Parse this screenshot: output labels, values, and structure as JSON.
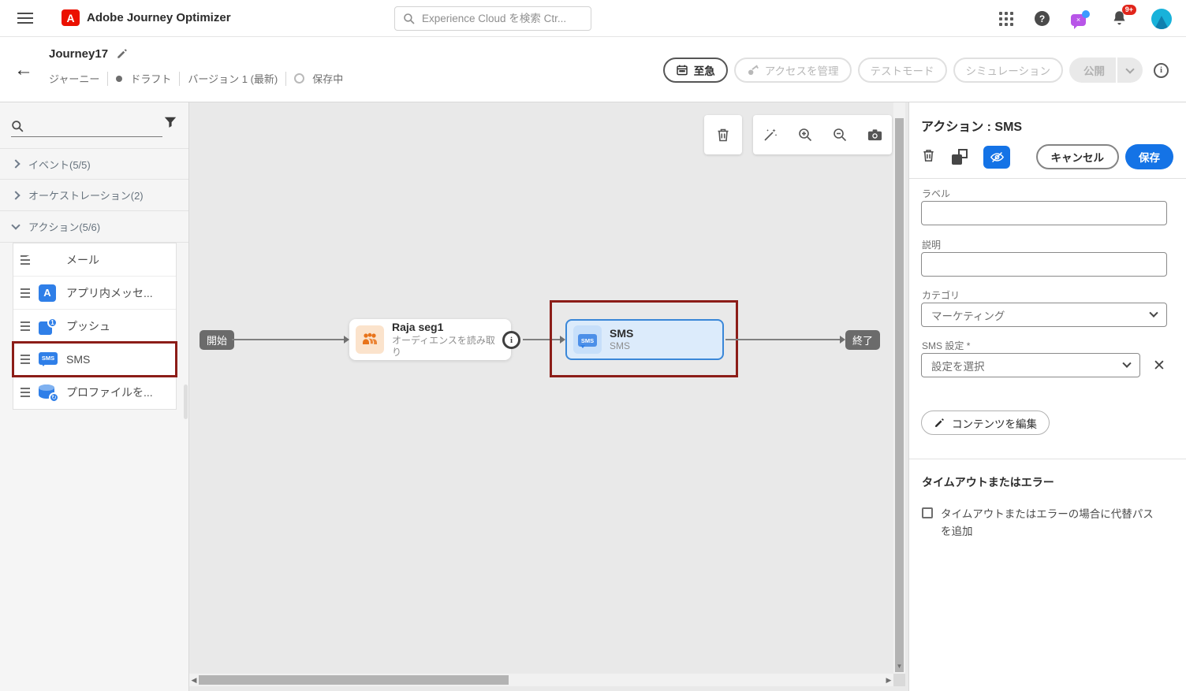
{
  "topbar": {
    "app_title": "Adobe Journey Optimizer",
    "logo_letter": "A",
    "search_placeholder": "Experience Cloud を検索 Ctr...",
    "help_glyph": "?",
    "notification_badge": "9+"
  },
  "header": {
    "title": "Journey17",
    "type_label": "ジャーニー",
    "status_label": "ドラフト",
    "version_label": "バージョン 1 (最新)",
    "saving_label": "保存中",
    "buttons": {
      "urgent": "至急",
      "manage_access": "アクセスを管理",
      "test_mode": "テストモード",
      "simulation": "シミュレーション",
      "publish": "公開",
      "info_glyph": "i"
    }
  },
  "sidebar": {
    "sections": [
      {
        "label": "イベント(5/5)"
      },
      {
        "label": "オーケストレーション(2)"
      },
      {
        "label": "アクション(5/6)"
      }
    ],
    "actions": [
      {
        "label": "メール",
        "icon": "email-icon"
      },
      {
        "label": "アプリ内メッセ...",
        "icon": "in-app-message-icon",
        "icon_letter": "A"
      },
      {
        "label": "プッシュ",
        "icon": "push-notification-icon",
        "icon_badge": "1"
      },
      {
        "label": "SMS",
        "icon": "sms-icon",
        "icon_letter": "SMS"
      },
      {
        "label": "プロファイルを...",
        "icon": "update-profile-icon",
        "icon_badge": "↻"
      }
    ]
  },
  "canvas": {
    "start_label": "開始",
    "end_label": "終了",
    "audience_node": {
      "title": "Raja seg1",
      "subtitle": "オーディエンスを読み取り",
      "info_glyph": "i"
    },
    "sms_node": {
      "title": "SMS",
      "subtitle": "SMS",
      "icon_letter": "SMS"
    }
  },
  "panel": {
    "title": "アクション : SMS",
    "cancel_label": "キャンセル",
    "save_label": "保存",
    "fields": {
      "label": {
        "label": "ラベル",
        "value": ""
      },
      "description": {
        "label": "説明",
        "value": ""
      },
      "category": {
        "label": "カテゴリ",
        "value": "マーケティング"
      },
      "sms_settings": {
        "label": "SMS 設定",
        "required_mark": "*",
        "value": "設定を選択"
      }
    },
    "edit_content_label": "コンテンツを編集",
    "timeout": {
      "heading": "タイムアウトまたはエラー",
      "checkbox_label": "タイムアウトまたはエラーの場合に代替パスを追加",
      "checked": false
    }
  },
  "colors": {
    "accent_blue": "#1473e6",
    "node_blue_border": "#3a87d8",
    "node_blue_bg": "#dcebfb",
    "selection_red": "#8c1d18",
    "badge_red": "#e1251b",
    "icon_blue": "#2f7fe8",
    "audience_orange": "#e8731a"
  }
}
